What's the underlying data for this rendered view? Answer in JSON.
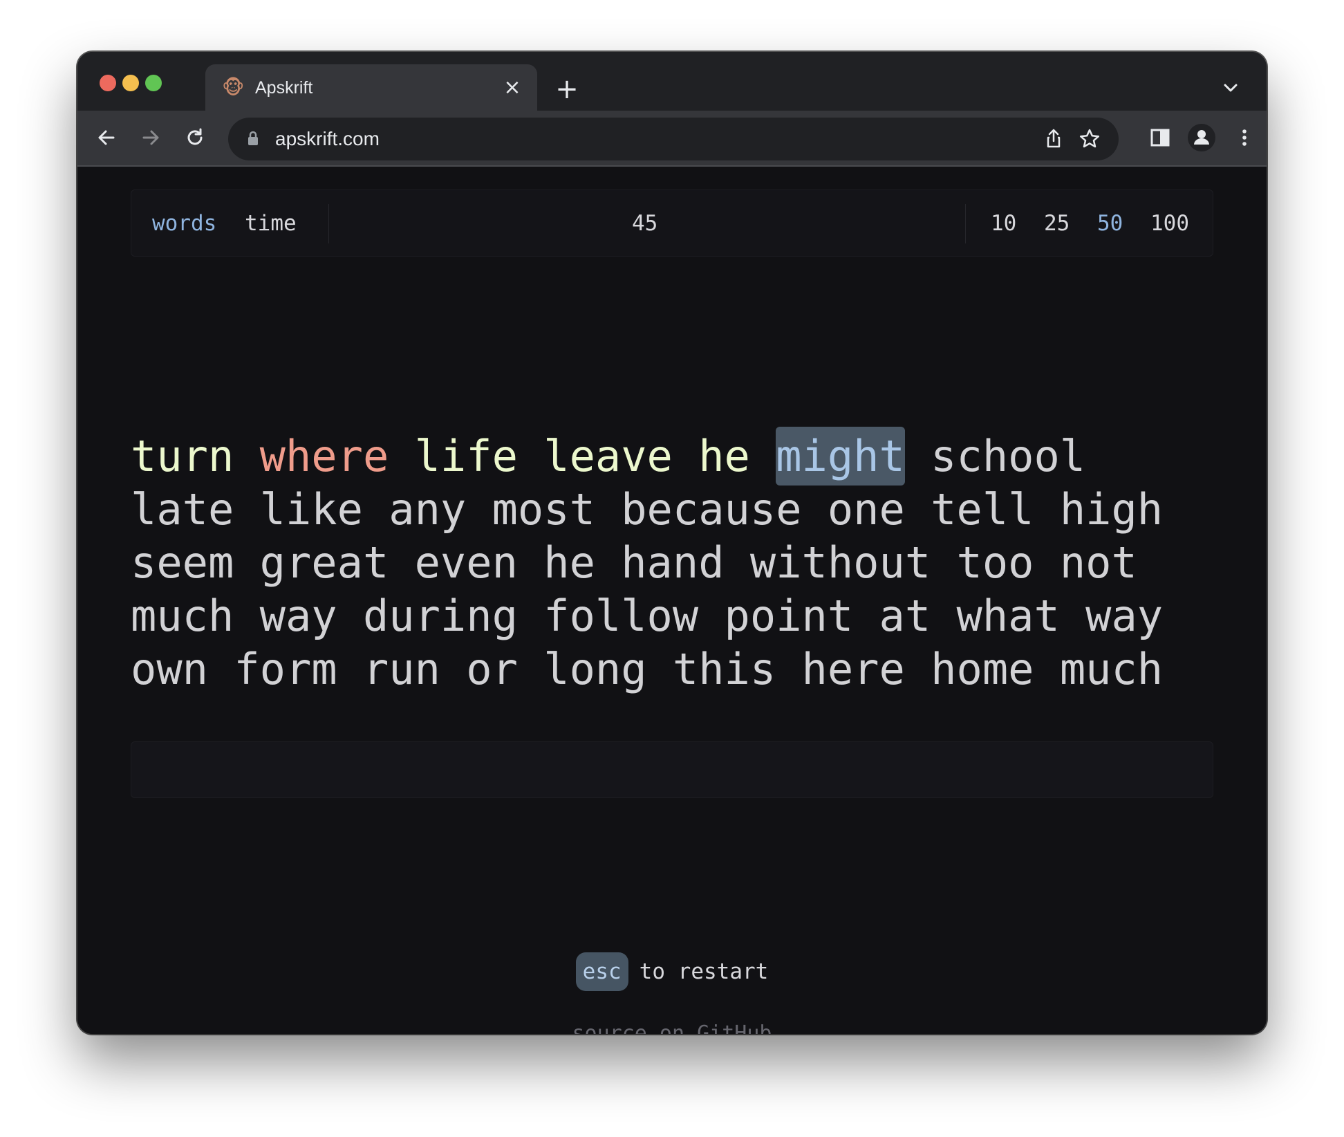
{
  "browser": {
    "tab_title": "Apskrift",
    "tab_favicon": "monkey-icon",
    "url": "apskrift.com",
    "icons": [
      "back-icon",
      "forward-icon",
      "reload-icon",
      "lock-icon",
      "share-icon",
      "star-icon",
      "side-panel-icon",
      "profile-icon",
      "menu-icon",
      "new-tab-icon",
      "close-icon",
      "chevron-down-icon"
    ]
  },
  "settings": {
    "modes": [
      {
        "label": "words",
        "active": true
      },
      {
        "label": "time",
        "active": false
      }
    ],
    "counter": "45",
    "word_counts": [
      {
        "label": "10",
        "active": false
      },
      {
        "label": "25",
        "active": false
      },
      {
        "label": "50",
        "active": true
      },
      {
        "label": "100",
        "active": false
      }
    ]
  },
  "test": {
    "words": [
      {
        "text": "turn",
        "state": "correct"
      },
      {
        "text": "where",
        "state": "wrong"
      },
      {
        "text": "life",
        "state": "correct"
      },
      {
        "text": "leave",
        "state": "correct"
      },
      {
        "text": "he",
        "state": "correct"
      },
      {
        "text": "might",
        "state": "current"
      },
      {
        "text": "school",
        "state": "pending"
      },
      {
        "text": "late",
        "state": "pending"
      },
      {
        "text": "like",
        "state": "pending"
      },
      {
        "text": "any",
        "state": "pending"
      },
      {
        "text": "most",
        "state": "pending"
      },
      {
        "text": "because",
        "state": "pending"
      },
      {
        "text": "one",
        "state": "pending"
      },
      {
        "text": "tell",
        "state": "pending"
      },
      {
        "text": "high",
        "state": "pending"
      },
      {
        "text": "seem",
        "state": "pending"
      },
      {
        "text": "great",
        "state": "pending"
      },
      {
        "text": "even",
        "state": "pending"
      },
      {
        "text": "he",
        "state": "pending"
      },
      {
        "text": "hand",
        "state": "pending"
      },
      {
        "text": "without",
        "state": "pending"
      },
      {
        "text": "too",
        "state": "pending"
      },
      {
        "text": "not",
        "state": "pending"
      },
      {
        "text": "much",
        "state": "pending"
      },
      {
        "text": "way",
        "state": "pending"
      },
      {
        "text": "during",
        "state": "pending"
      },
      {
        "text": "follow",
        "state": "pending"
      },
      {
        "text": "point",
        "state": "pending"
      },
      {
        "text": "at",
        "state": "pending"
      },
      {
        "text": "what",
        "state": "pending"
      },
      {
        "text": "way",
        "state": "pending"
      },
      {
        "text": "own",
        "state": "pending"
      },
      {
        "text": "form",
        "state": "pending"
      },
      {
        "text": "run",
        "state": "pending"
      },
      {
        "text": "or",
        "state": "pending"
      },
      {
        "text": "long",
        "state": "pending"
      },
      {
        "text": "this",
        "state": "pending"
      },
      {
        "text": "here",
        "state": "pending"
      },
      {
        "text": "home",
        "state": "pending"
      },
      {
        "text": "much",
        "state": "pending"
      }
    ],
    "input_value": ""
  },
  "footer": {
    "key": "esc",
    "hint": "to restart",
    "source_link": "source on GitHub"
  },
  "colors": {
    "background": "#111114",
    "correct": "#ecf8cd",
    "wrong": "#ef9c8b",
    "pending": "#d2d2d5",
    "accent": "#8fb4df",
    "current_bg": "#4a5866"
  }
}
